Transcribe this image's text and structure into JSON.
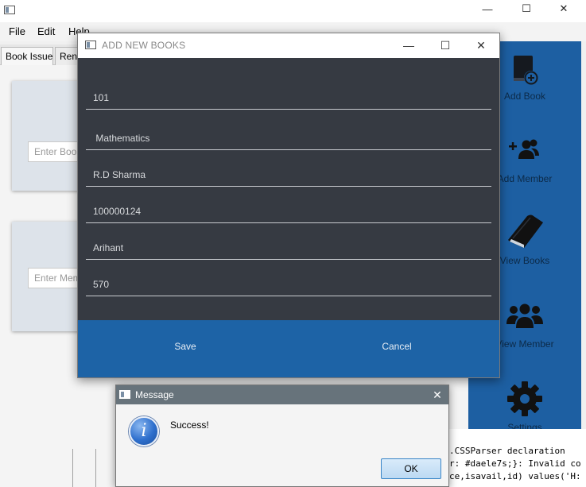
{
  "main_window": {
    "menu": [
      "File",
      "Edit",
      "Help"
    ],
    "tabs": [
      "Book Issue",
      "Renew"
    ],
    "book_input_placeholder": "Enter Book ID",
    "member_input_placeholder": "Enter Member ID"
  },
  "sidebar": {
    "items": [
      {
        "label": "Add Book",
        "icon": "book-plus-icon"
      },
      {
        "label": "Add Member",
        "icon": "add-user-icon"
      },
      {
        "label": "View Books",
        "icon": "books-icon"
      },
      {
        "label": "View Member",
        "icon": "users-icon"
      },
      {
        "label": "Settings",
        "icon": "gear-icon"
      }
    ]
  },
  "console": {
    "lines": [
      ".CSSParser declaration",
      "r: #daele7s;}: Invalid co",
      "ce,isavail,id) values('H:"
    ]
  },
  "books_dialog": {
    "title": "ADD NEW BOOKS",
    "fields": [
      {
        "name": "book-id-field",
        "value": "101"
      },
      {
        "name": "book-title-field",
        "value": " Mathematics"
      },
      {
        "name": "author-field",
        "value": "R.D Sharma"
      },
      {
        "name": "isbn-field",
        "value": "100000124"
      },
      {
        "name": "publisher-field",
        "value": "Arihant"
      },
      {
        "name": "price-field",
        "value": "570"
      }
    ],
    "save_label": "Save",
    "cancel_label": "Cancel"
  },
  "message_dialog": {
    "title": "Message",
    "text": "Success!",
    "ok_label": "OK"
  },
  "colors": {
    "sidebar_bg": "#1d5fa2",
    "dialog_bg": "#363a42",
    "dialog_footer": "#1d63a6",
    "message_titlebar": "#67737b"
  }
}
